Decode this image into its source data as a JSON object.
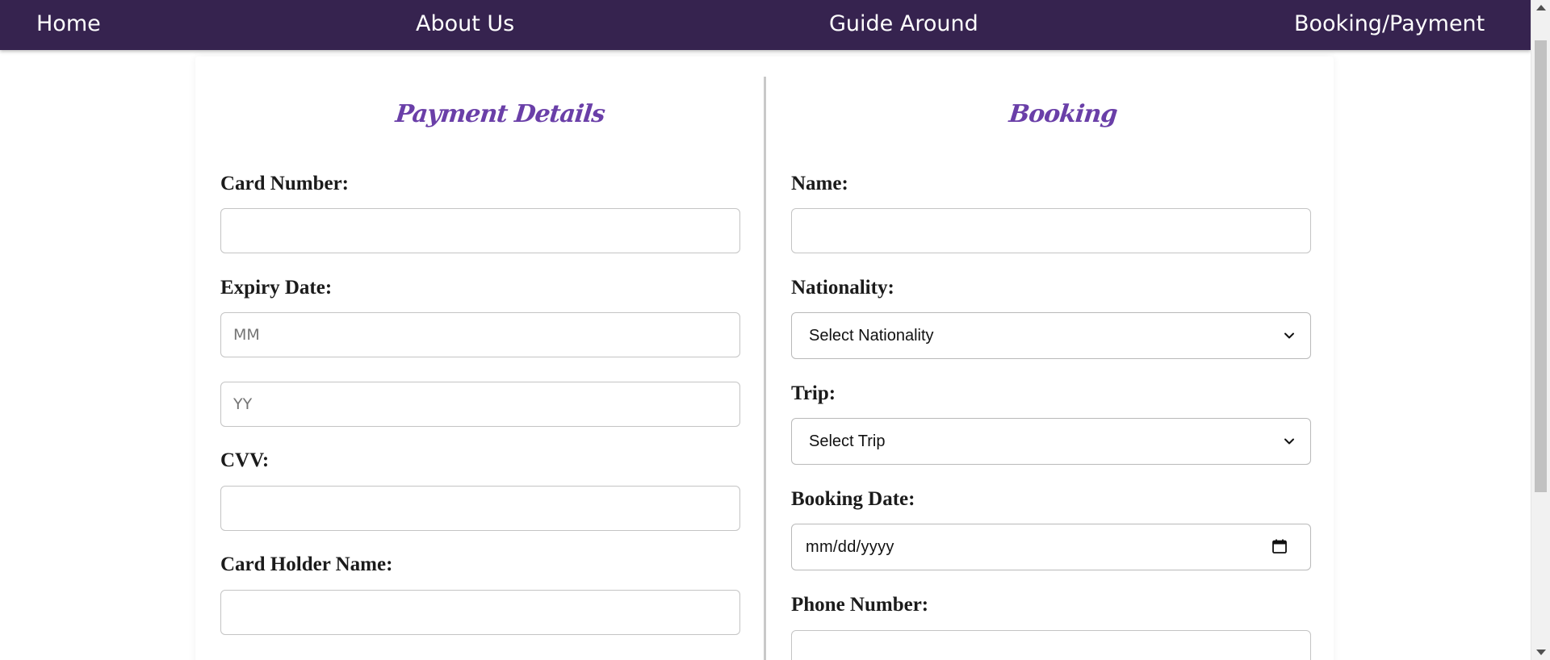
{
  "nav": {
    "home": "Home",
    "about": "About Us",
    "guide": "Guide Around",
    "booking": "Booking/Payment"
  },
  "payment": {
    "title": "Payment Details",
    "card_number_label": "Card Number:",
    "card_number_value": "",
    "expiry_label": "Expiry Date:",
    "month_placeholder": "MM",
    "year_placeholder": "YY",
    "cvv_label": "CVV:",
    "cvv_value": "",
    "holder_label": "Card Holder Name:",
    "holder_value": ""
  },
  "booking": {
    "title": "Booking",
    "name_label": "Name:",
    "name_value": "",
    "nationality_label": "Nationality:",
    "nationality_selected": "Select Nationality",
    "trip_label": "Trip:",
    "trip_selected": "Select Trip",
    "date_label": "Booking Date:",
    "date_value": "mm/dd/yyyy",
    "phone_label": "Phone Number:",
    "phone_value": ""
  },
  "colors": {
    "navbar": "#36234f",
    "accent_title": "#6a3fa8"
  },
  "icons": {
    "select_arrow": "chevron-down-icon",
    "date_picker": "calendar-icon"
  }
}
